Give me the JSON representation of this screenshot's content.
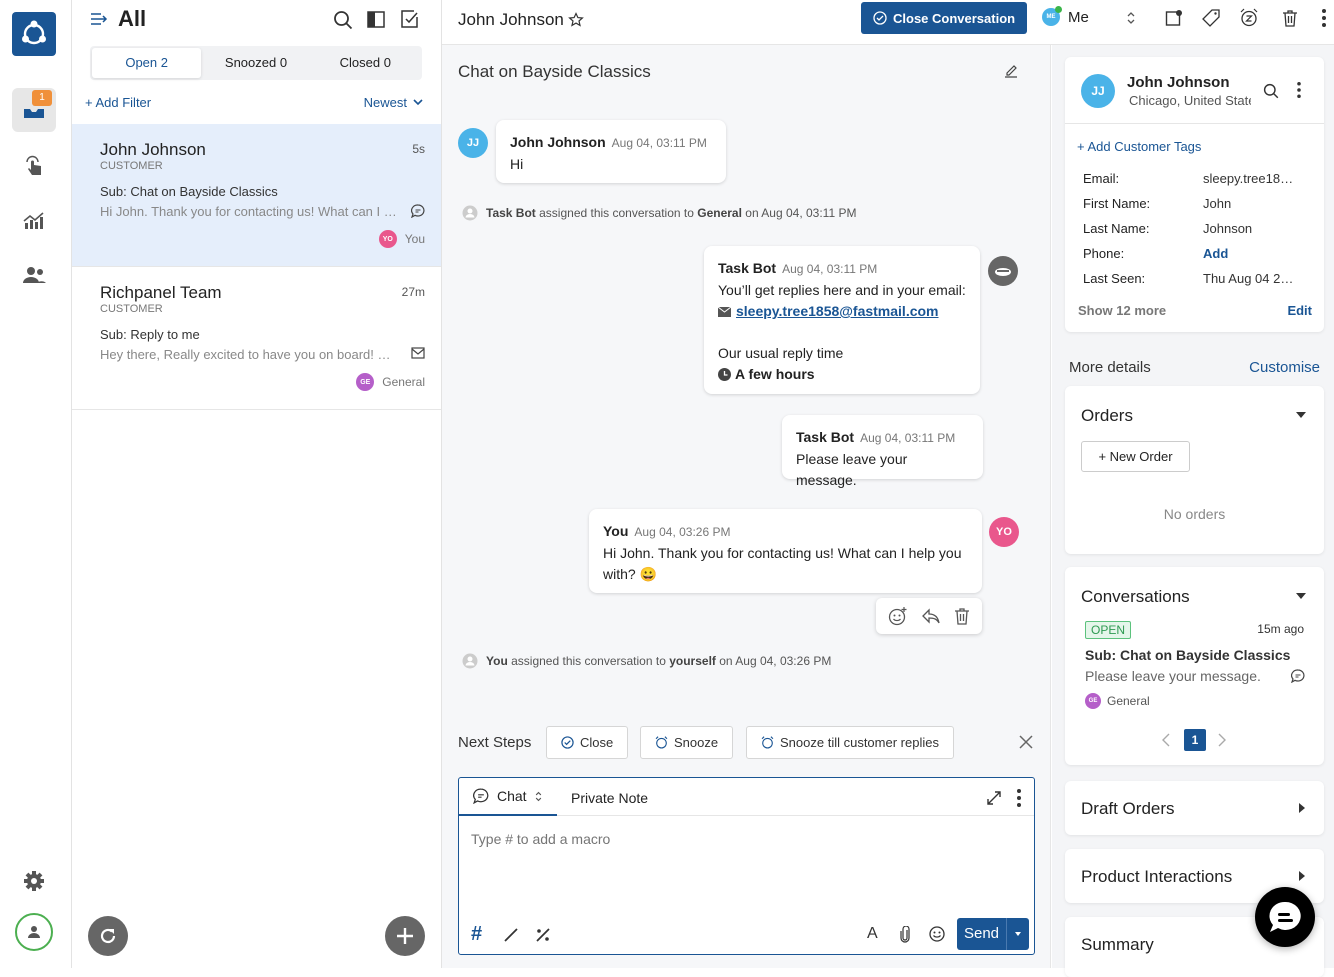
{
  "rail": {
    "inbox_badge": "1",
    "items": [
      "inbox-icon",
      "touch-icon",
      "analytics-icon",
      "users-icon"
    ],
    "bottom": [
      "settings-icon",
      "profile-icon"
    ]
  },
  "list": {
    "title": "All",
    "tabs": [
      {
        "label": "Open 2",
        "active": true
      },
      {
        "label": "Snoozed 0",
        "active": false
      },
      {
        "label": "Closed 0",
        "active": false
      }
    ],
    "add_filter": "+ Add Filter",
    "sort": "Newest",
    "conversations": [
      {
        "name": "John Johnson",
        "type": "CUSTOMER",
        "time": "5s",
        "subject": "Sub: Chat on Bayside Classics",
        "preview": "Hi John. Thank you for contacting us! What can I help you with?",
        "channel": "chat-icon",
        "assignee_initials": "YO",
        "assignee": "You",
        "assignee_color": "#e9578c",
        "selected": true
      },
      {
        "name": "Richpanel Team",
        "type": "CUSTOMER",
        "time": "27m",
        "subject": "Sub: Reply to me",
        "preview": "Hey there, Really excited to have you on board! We're glad",
        "channel": "email-icon",
        "assignee_initials": "GE",
        "assignee": "General",
        "assignee_color": "#b55fc9",
        "selected": false
      }
    ]
  },
  "header": {
    "contact_name": "John Johnson",
    "close_conversation": "Close Conversation",
    "assignee_initials": "ME",
    "assignee": "Me"
  },
  "chat": {
    "title": "Chat on Bayside Classics",
    "messages": [
      {
        "author": "John Johnson",
        "time": "Aug 04, 03:11 PM",
        "text": "Hi",
        "initials": "JJ"
      },
      {
        "author": "Task Bot",
        "time": "Aug 04, 03:11 PM",
        "line1": "You’ll get replies here and in your email:",
        "email": "sleepy.tree1858@fastmail.com",
        "line2": "Our usual reply time",
        "line3": "A few hours"
      },
      {
        "author": "Task Bot",
        "time": "Aug 04, 03:11 PM",
        "text": "Please leave your message."
      },
      {
        "author": "You",
        "time": "Aug 04, 03:26 PM",
        "text": "Hi John. Thank you for contacting us! What can I help you with? 😀",
        "initials": "YO"
      }
    ],
    "system_events": [
      {
        "actor": "Task Bot",
        "mid": " assigned this conversation to ",
        "target": "General",
        "tail": " on Aug 04, 03:11 PM"
      },
      {
        "actor": "You",
        "mid": " assigned this conversation to ",
        "target": "yourself",
        "tail": " on Aug 04, 03:26 PM"
      }
    ],
    "next_steps": {
      "label": "Next Steps",
      "close": "Close",
      "snooze": "Snooze",
      "snooze_till": "Snooze till customer replies"
    },
    "composer": {
      "tab_chat": "Chat",
      "tab_note": "Private Note",
      "placeholder": "Type # to add a macro",
      "send": "Send"
    }
  },
  "customer": {
    "initials": "JJ",
    "name": "John Johnson",
    "location": "Chicago, United States",
    "add_tags": "+ Add Customer Tags",
    "fields": [
      {
        "label": "Email:",
        "value": "sleepy.tree18…"
      },
      {
        "label": "First Name:",
        "value": "John"
      },
      {
        "label": "Last Name:",
        "value": "Johnson"
      },
      {
        "label": "Phone:",
        "value": "Add"
      },
      {
        "label": "Last Seen:",
        "value": "Thu Aug 04 2…"
      }
    ],
    "show_more": "Show 12 more",
    "edit": "Edit"
  },
  "details": {
    "title": "More details",
    "customise": "Customise",
    "orders": {
      "title": "Orders",
      "new_order": "+ New Order",
      "empty": "No orders"
    },
    "conversations": {
      "title": "Conversations",
      "status": "OPEN",
      "ago": "15m ago",
      "subject": "Sub: Chat on Bayside Classics",
      "preview": "Please leave your message.",
      "assignee_initials": "GE",
      "assignee": "General",
      "page": "1"
    },
    "draft_orders": "Draft Orders",
    "product_interactions": "Product Interactions",
    "summary": "Summary"
  }
}
